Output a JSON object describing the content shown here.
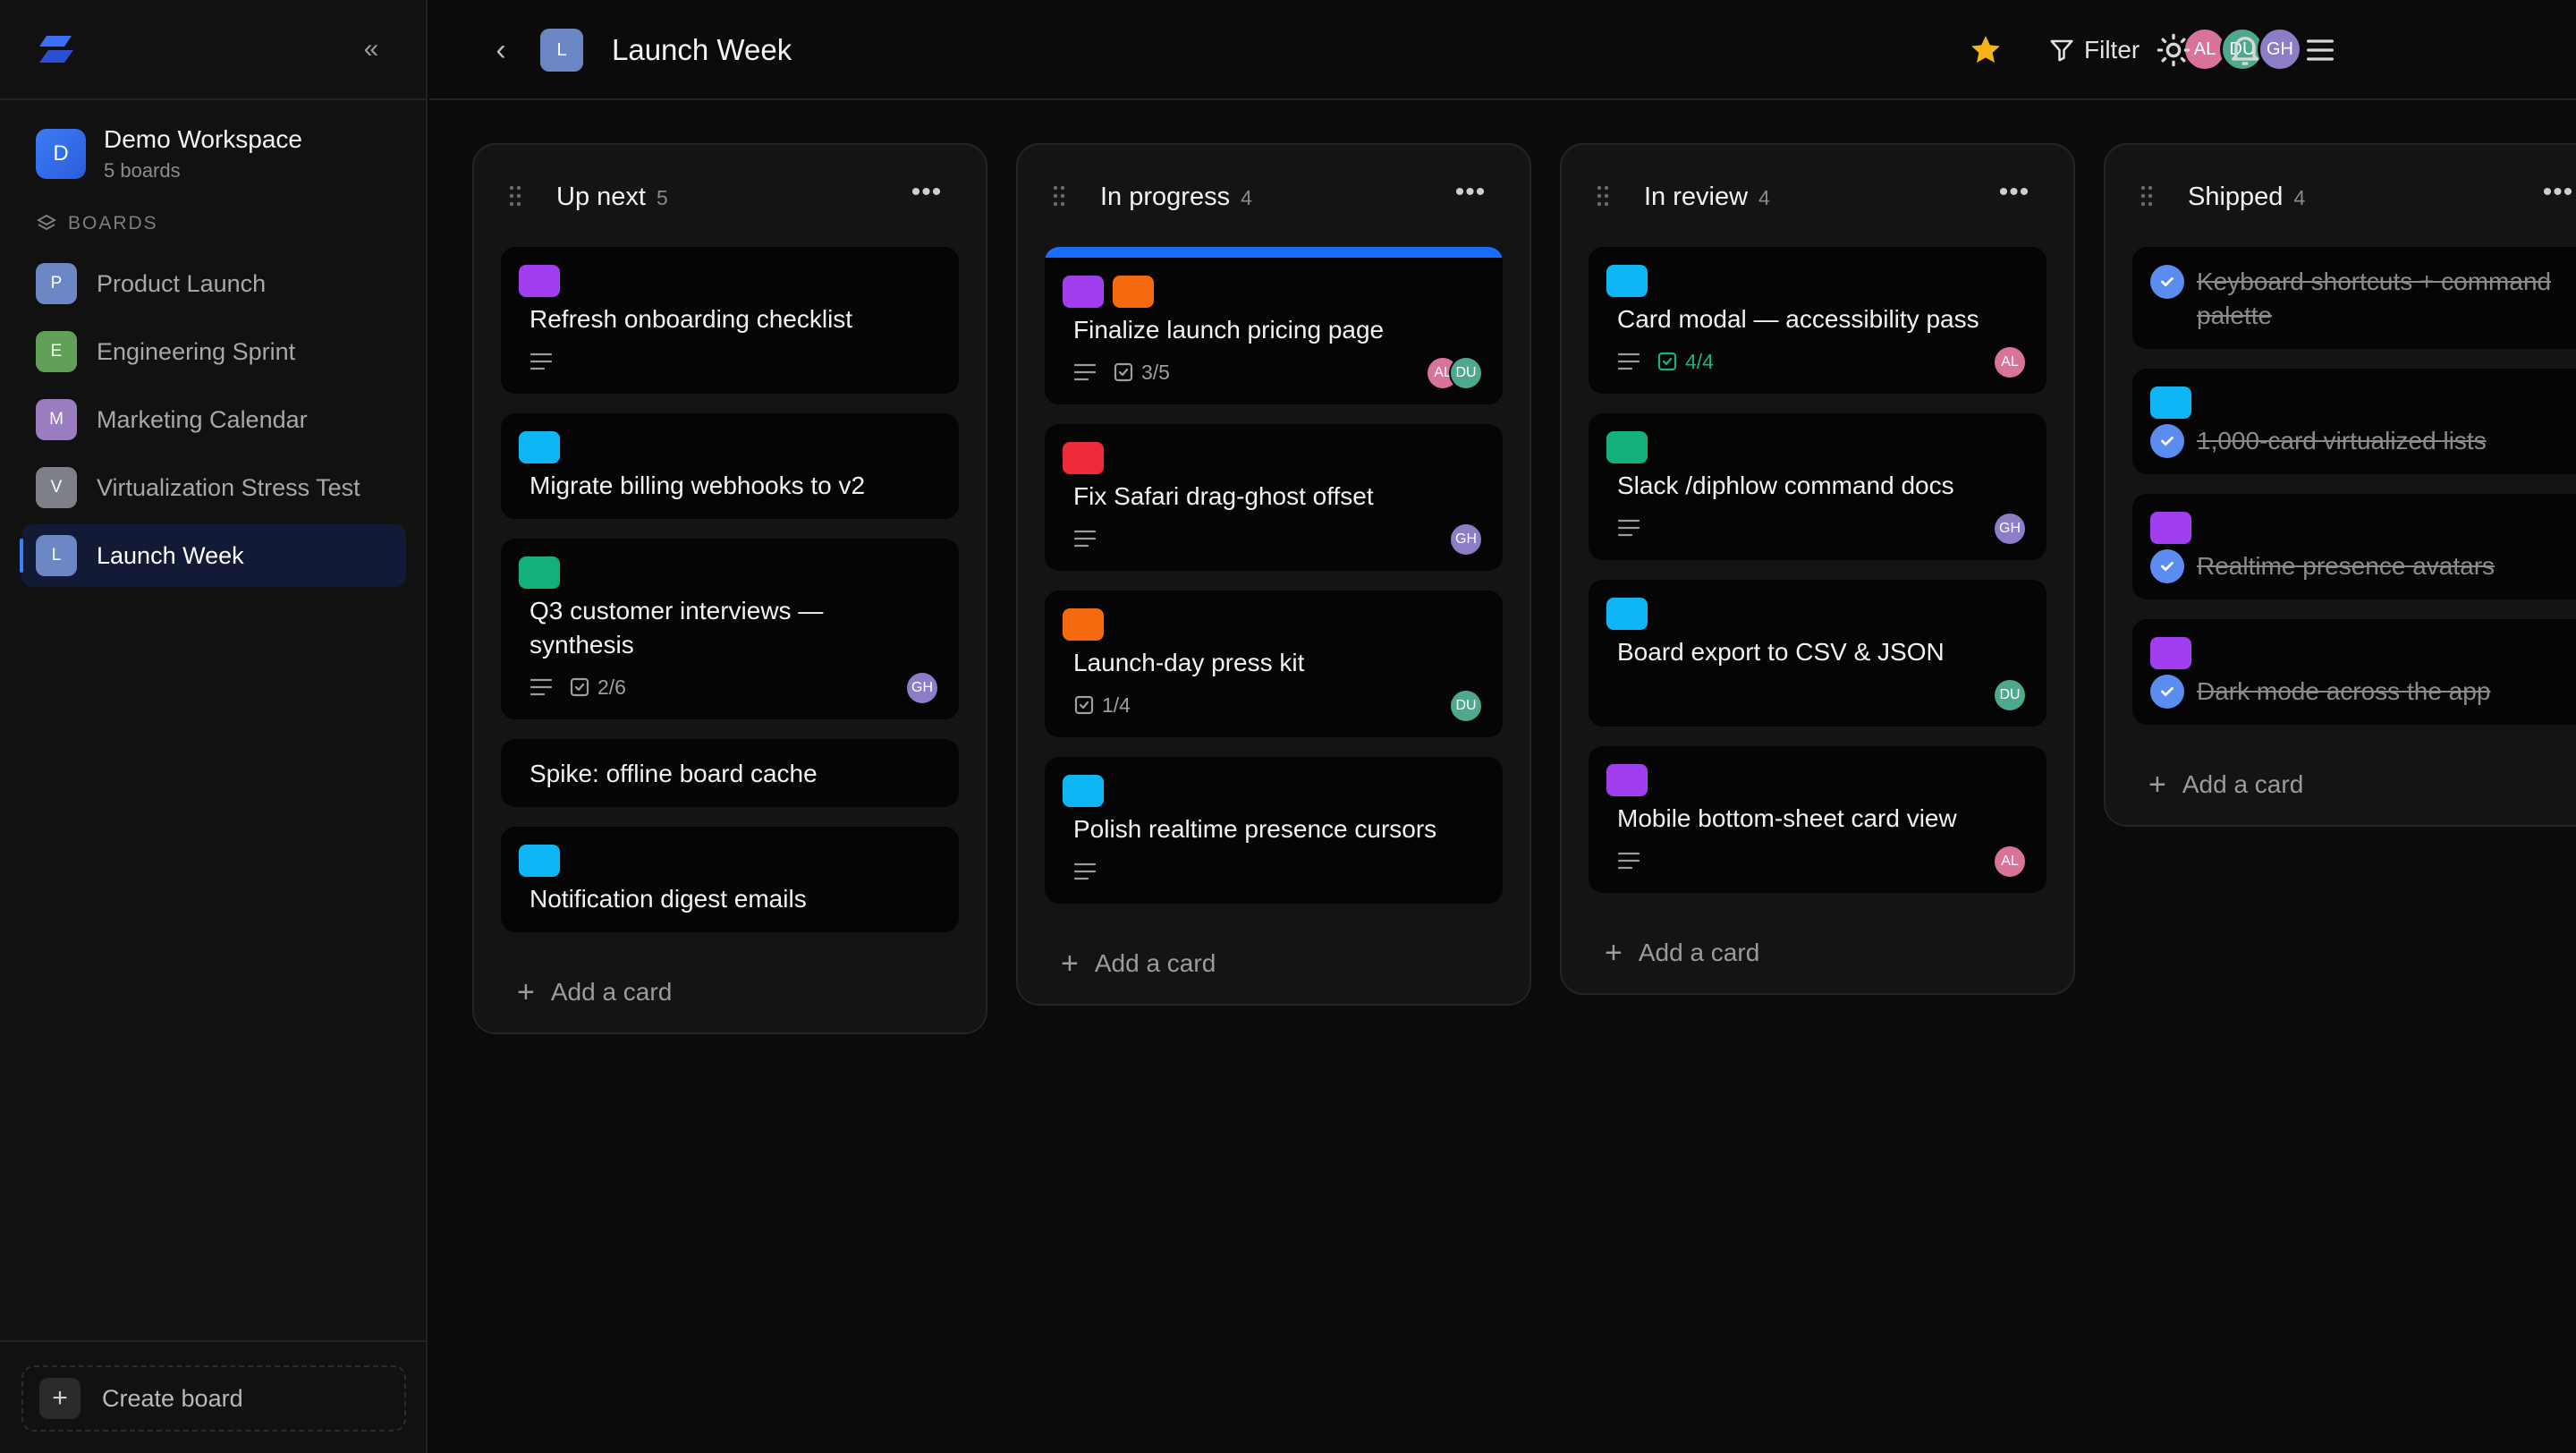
{
  "workspace": {
    "initial": "D",
    "name": "Demo Workspace",
    "sub": "5 boards"
  },
  "sidebar": {
    "section_label": "BOARDS",
    "boards": [
      {
        "initial": "P",
        "label": "Product Launch",
        "color": "#6c88c4"
      },
      {
        "initial": "E",
        "label": "Engineering Sprint",
        "color": "#62a05a"
      },
      {
        "initial": "M",
        "label": "Marketing Calendar",
        "color": "#9a7cc0"
      },
      {
        "initial": "V",
        "label": "Virtualization Stress Test",
        "color": "#7d8088"
      },
      {
        "initial": "L",
        "label": "Launch Week",
        "color": "#6c88c4",
        "active": true
      }
    ],
    "create_label": "Create board"
  },
  "header": {
    "board_initial": "L",
    "board_title": "Launch Week",
    "filter_label": "Filter",
    "presence": [
      {
        "initials": "AL",
        "color": "#d9739a"
      },
      {
        "initials": "DU",
        "color": "#4ea88e"
      },
      {
        "initials": "GH",
        "color": "#8d7cc6"
      }
    ]
  },
  "columns": [
    {
      "title": "Up next",
      "count": "5",
      "cards": [
        {
          "labels": [
            "#a13ef0"
          ],
          "title": "Refresh onboarding checklist",
          "desc": true
        },
        {
          "labels": [
            "#0fb6f5"
          ],
          "title": "Migrate billing webhooks to v2"
        },
        {
          "labels": [
            "#14b07a"
          ],
          "title": "Q3 customer interviews — synthesis",
          "desc": true,
          "check": "2/6",
          "avatars": [
            {
              "initials": "GH",
              "color": "#8d7cc6"
            }
          ]
        },
        {
          "title": "Spike: offline board cache"
        },
        {
          "labels": [
            "#0fb6f5"
          ],
          "title": "Notification digest emails"
        }
      ]
    },
    {
      "title": "In progress",
      "count": "4",
      "cards": [
        {
          "accent": true,
          "labels": [
            "#a13ef0",
            "#f56a0f"
          ],
          "title": "Finalize launch pricing page",
          "desc": true,
          "check": "3/5",
          "avatars": [
            {
              "initials": "AL",
              "color": "#d9739a"
            },
            {
              "initials": "DU",
              "color": "#4ea88e"
            }
          ]
        },
        {
          "labels": [
            "#ee2b3b"
          ],
          "title": "Fix Safari drag-ghost offset",
          "desc": true,
          "avatars": [
            {
              "initials": "GH",
              "color": "#8d7cc6"
            }
          ]
        },
        {
          "labels": [
            "#f56a0f"
          ],
          "title": "Launch-day press kit",
          "check": "1/4",
          "avatars": [
            {
              "initials": "DU",
              "color": "#4ea88e"
            }
          ]
        },
        {
          "labels": [
            "#0fb6f5"
          ],
          "title": "Polish realtime presence cursors",
          "desc": true
        }
      ]
    },
    {
      "title": "In review",
      "count": "4",
      "cards": [
        {
          "labels": [
            "#0fb6f5"
          ],
          "title": "Card modal — accessibility pass",
          "desc": true,
          "check": "4/4",
          "check_done": true,
          "avatars": [
            {
              "initials": "AL",
              "color": "#d9739a"
            }
          ]
        },
        {
          "labels": [
            "#14b07a"
          ],
          "title": "Slack /diphlow command docs",
          "desc": true,
          "avatars": [
            {
              "initials": "GH",
              "color": "#8d7cc6"
            }
          ]
        },
        {
          "labels": [
            "#0fb6f5"
          ],
          "title": "Board export to CSV & JSON",
          "avatars": [
            {
              "initials": "DU",
              "color": "#4ea88e"
            }
          ]
        },
        {
          "labels": [
            "#a13ef0"
          ],
          "title": "Mobile bottom-sheet card view",
          "desc": true,
          "avatars": [
            {
              "initials": "AL",
              "color": "#d9739a"
            }
          ]
        }
      ]
    },
    {
      "title": "Shipped",
      "count": "4",
      "cards": [
        {
          "done": true,
          "title": "Keyboard shortcuts + command palette"
        },
        {
          "done": true,
          "labels": [
            "#0fb6f5"
          ],
          "title": "1,000-card virtualized lists"
        },
        {
          "done": true,
          "labels": [
            "#a13ef0"
          ],
          "title": "Realtime presence avatars"
        },
        {
          "done": true,
          "labels": [
            "#a13ef0"
          ],
          "title": "Dark mode across the app"
        }
      ]
    }
  ],
  "add_card_label": "Add a card",
  "colors": {
    "accent": "#3b82f6",
    "star": "#f5b31a"
  },
  "icons": [
    "logo-icon",
    "collapse-sidebar-icon",
    "back-arrow-icon",
    "star-icon",
    "filter-icon",
    "theme-sun-icon",
    "bell-icon",
    "menu-icon",
    "drag-handle-icon",
    "more-icon",
    "description-icon",
    "checklist-icon",
    "plus-icon",
    "check-circle-icon",
    "layers-icon"
  ]
}
